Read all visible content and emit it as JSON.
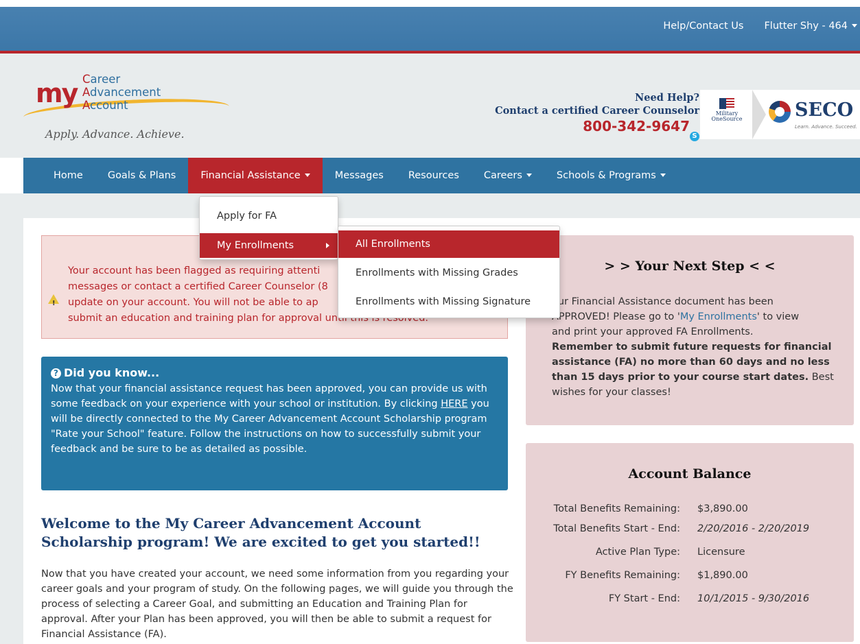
{
  "topbar": {
    "help_link": "Help/Contact Us",
    "user_menu": "Flutter Shy - 464"
  },
  "logo": {
    "my": "my",
    "line1": "areer",
    "line1_initial": "C",
    "line2": "dvancement",
    "line2_initial": "A",
    "line3": "ccount",
    "line3_initial": "A",
    "tagline": "Apply. Advance. Achieve."
  },
  "help": {
    "title": "Need Help?",
    "subtitle": "Contact a certified Career Counselor",
    "phone": "800-342-9647"
  },
  "partners": {
    "mos_line1": "Military",
    "mos_line2": "OneSource",
    "seco": "SECO",
    "seco_sub": "Learn. Advance. Succeed."
  },
  "nav": {
    "items": [
      {
        "label": "Home"
      },
      {
        "label": "Goals & Plans"
      },
      {
        "label": "Financial Assistance"
      },
      {
        "label": "Messages"
      },
      {
        "label": "Resources"
      },
      {
        "label": "Careers"
      },
      {
        "label": "Schools & Programs"
      }
    ]
  },
  "fa_menu": {
    "items": [
      {
        "label": "Apply for FA"
      },
      {
        "label": "My Enrollments"
      }
    ]
  },
  "enrollments_menu": {
    "items": [
      {
        "label": "All Enrollments"
      },
      {
        "label": "Enrollments with Missing Grades"
      },
      {
        "label": "Enrollments with Missing Signature"
      }
    ]
  },
  "alert": {
    "lines": [
      "Your account has been flagged as requiring attenti",
      "messages or contact a certified Career Counselor (8",
      "update on your account. You will not be able to ap",
      "submit an education and training plan for approval until this is resolved."
    ]
  },
  "did_you_know": {
    "title": "Did you know...",
    "text_before": "Now that your financial assistance request has been approved, you can provide us with some feedback on your experience with your school or institution. By clicking ",
    "here": "HERE",
    "text_after": " you will be directly connected to the My Career Advancement Account Scholarship program \"Rate your School\" feature. Follow the instructions on how to successfully submit your feedback and be sure to be as detailed as possible."
  },
  "welcome": {
    "title": "Welcome to the My Career Advancement Account Scholarship program! We are excited to get you started!!",
    "body": "Now that you have created your account, we need some information from you regarding your career goals and your program of study. On the following pages, we will guide you through the process of selecting a Career Goal, and submitting an Education and Training Plan for approval. After your Plan has been approved, you will then be able to submit a request for Financial Assistance (FA)."
  },
  "next_step": {
    "title": "> > Your Next Step < <",
    "line1": "our Financial Assistance document has been",
    "line2a": "APPROVED! Please go to '",
    "link": "My Enrollments",
    "line2b": "' to view",
    "line3": "and print your approved FA Enrollments.",
    "bold": "Remember to submit future requests for financial assistance (FA) no more than 60 days and no less than 15 days prior to your course start dates.",
    "tail": " Best wishes for your classes!"
  },
  "balance": {
    "title": "Account Balance",
    "rows": [
      {
        "label": "Total Benefits Remaining:",
        "value": "$3,890.00"
      },
      {
        "label": "Total Benefits Start - End:",
        "value": "2/20/2016 - 2/20/2019"
      },
      {
        "label": "Active Plan Type:",
        "value": "Licensure"
      },
      {
        "label": "FY Benefits Remaining:",
        "value": "$1,890.00"
      },
      {
        "label": "FY Start - End:",
        "value": "10/1/2015 - 9/30/2016"
      }
    ]
  },
  "colors": {
    "nav_blue": "#2f73a1",
    "brand_red": "#b8262c",
    "panel_pink": "#e8d2d4",
    "info_blue": "#2577a4"
  }
}
